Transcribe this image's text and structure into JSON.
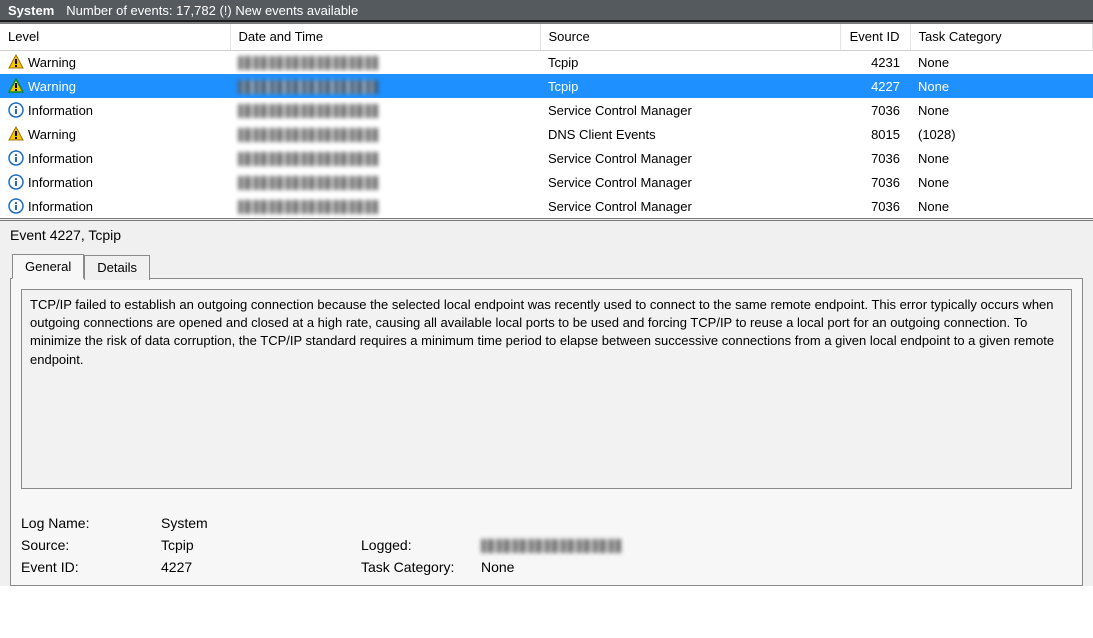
{
  "titlebar": {
    "label": "System",
    "status": "Number of events: 17,782 (!) New events available"
  },
  "columns": {
    "level": "Level",
    "datetime": "Date and Time",
    "source": "Source",
    "eventid": "Event ID",
    "taskcat": "Task Category"
  },
  "rows": [
    {
      "level": "Warning",
      "icon": "warning",
      "datetime_obscured": true,
      "source": "Tcpip",
      "eventid": "4231",
      "taskcat": "None",
      "selected": false
    },
    {
      "level": "Warning",
      "icon": "warning-green",
      "datetime_obscured": true,
      "source": "Tcpip",
      "eventid": "4227",
      "taskcat": "None",
      "selected": true
    },
    {
      "level": "Information",
      "icon": "info",
      "datetime_obscured": true,
      "source": "Service Control Manager",
      "eventid": "7036",
      "taskcat": "None",
      "selected": false
    },
    {
      "level": "Warning",
      "icon": "warning",
      "datetime_obscured": true,
      "source": "DNS Client Events",
      "eventid": "8015",
      "taskcat": "(1028)",
      "selected": false
    },
    {
      "level": "Information",
      "icon": "info",
      "datetime_obscured": true,
      "source": "Service Control Manager",
      "eventid": "7036",
      "taskcat": "None",
      "selected": false
    },
    {
      "level": "Information",
      "icon": "info",
      "datetime_obscured": true,
      "source": "Service Control Manager",
      "eventid": "7036",
      "taskcat": "None",
      "selected": false
    },
    {
      "level": "Information",
      "icon": "info",
      "datetime_obscured": true,
      "source": "Service Control Manager",
      "eventid": "7036",
      "taskcat": "None",
      "selected": false
    }
  ],
  "detail": {
    "title": "Event 4227, Tcpip",
    "tabs": {
      "general": "General",
      "details": "Details"
    },
    "message": "TCP/IP failed to establish an outgoing connection because the selected local endpoint was recently used to connect to the same remote endpoint. This error typically occurs when outgoing connections are opened and closed at a high rate, causing all available local ports to be used and forcing TCP/IP to reuse a local port for an outgoing connection. To minimize the risk of data corruption, the TCP/IP standard requires a minimum time period to elapse between successive connections from a given local endpoint to a given remote endpoint.",
    "props": {
      "logname_k": "Log Name:",
      "logname_v": "System",
      "source_k": "Source:",
      "source_v": "Tcpip",
      "logged_k": "Logged:",
      "logged_obscured": true,
      "eventid_k": "Event ID:",
      "eventid_v": "4227",
      "taskcat_k": "Task Category:",
      "taskcat_v": "None"
    }
  },
  "icons": {
    "warning": "warning-icon",
    "warning-green": "warning-overlay-icon",
    "info": "info-icon"
  }
}
